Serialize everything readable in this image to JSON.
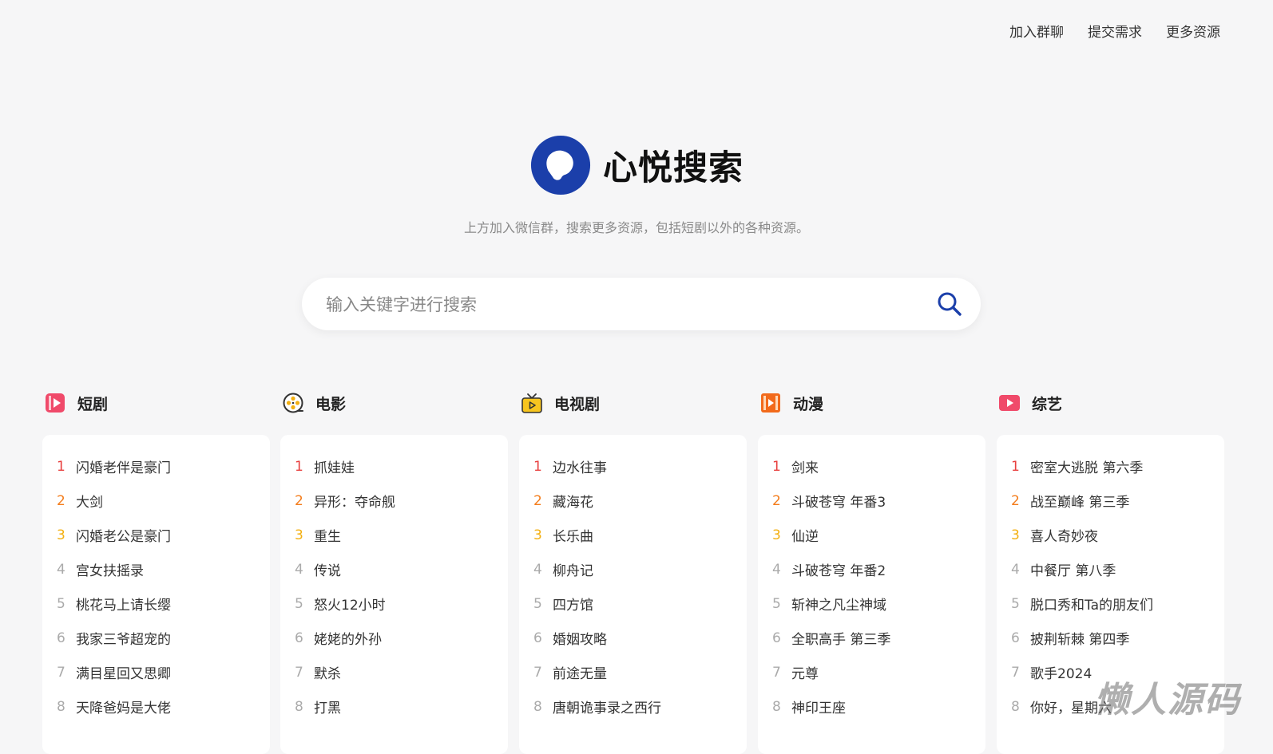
{
  "nav": {
    "links": [
      "加入群聊",
      "提交需求",
      "更多资源"
    ]
  },
  "brand": {
    "name": "心悦搜索",
    "color": "#1b3faa"
  },
  "subtitle": "上方加入微信群，搜索更多资源，包括短剧以外的各种资源。",
  "search": {
    "placeholder": "输入关键字进行搜索",
    "value": ""
  },
  "columns": [
    {
      "title": "短剧",
      "icon": "short-drama-icon",
      "items": [
        "闪婚老伴是豪门",
        "大剑",
        "闪婚老公是豪门",
        "宫女扶摇录",
        "桃花马上请长缨",
        "我家三爷超宠的",
        "满目星回又思卿",
        "天降爸妈是大佬"
      ]
    },
    {
      "title": "电影",
      "icon": "movie-reel-icon",
      "items": [
        "抓娃娃",
        "异形：夺命舰",
        "重生",
        "传说",
        "怒火12小时",
        "姥姥的外孙",
        "默杀",
        "打黑"
      ]
    },
    {
      "title": "电视剧",
      "icon": "tv-icon",
      "items": [
        "边水往事",
        "藏海花",
        "长乐曲",
        "柳舟记",
        "四方馆",
        "婚姻攻略",
        "前途无量",
        "唐朝诡事录之西行"
      ]
    },
    {
      "title": "动漫",
      "icon": "anime-icon",
      "items": [
        "剑来",
        "斗破苍穹 年番3",
        "仙逆",
        "斗破苍穹 年番2",
        "斩神之凡尘神域",
        "全职高手 第三季",
        "元尊",
        "神印王座"
      ]
    },
    {
      "title": "综艺",
      "icon": "variety-icon",
      "items": [
        "密室大逃脱 第六季",
        "战至巅峰 第三季",
        "喜人奇妙夜",
        "中餐厅 第八季",
        "脱口秀和Ta的朋友们",
        "披荆斩棘 第四季",
        "歌手2024",
        "你好，星期六"
      ]
    }
  ],
  "watermark": "懒人源码"
}
